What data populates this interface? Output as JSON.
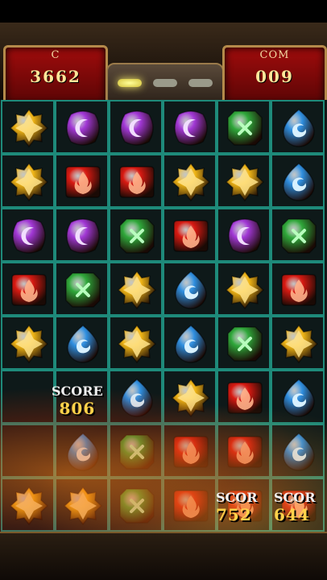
{
  "hud": {
    "score_label": "C",
    "score_value": "3662",
    "combo_label": "COM",
    "combo_value": "009",
    "time_progress": 0.73
  },
  "board": {
    "columns": 6,
    "rows": 8,
    "grid": [
      [
        "yellow",
        "purple",
        "purple",
        "purple",
        "green",
        "blue"
      ],
      [
        "yellow",
        "red",
        "red",
        "yellow",
        "yellow",
        "blue"
      ],
      [
        "purple",
        "purple",
        "green",
        "red",
        "purple",
        "green"
      ],
      [
        "red",
        "green",
        "yellow",
        "blue",
        "yellow",
        "red"
      ],
      [
        "yellow",
        "blue",
        "yellow",
        "blue",
        "green",
        "yellow"
      ],
      [
        "empty",
        "empty",
        "blue",
        "yellow",
        "red",
        "blue"
      ],
      [
        "empty",
        "blue",
        "green",
        "red",
        "red",
        "blue"
      ],
      [
        "yellow",
        "yellow",
        "green",
        "red",
        "red",
        "red"
      ]
    ]
  },
  "score_popups": [
    {
      "label": "SCORE",
      "value": "806"
    },
    {
      "label": "SCOR",
      "value": "752"
    },
    {
      "label": "SCOR",
      "value": "644"
    }
  ],
  "gem_colors": {
    "yellow": "#f1b616",
    "purple": "#a238d6",
    "red": "#d81a12",
    "green": "#2fa73a",
    "blue": "#2f8fe0"
  }
}
